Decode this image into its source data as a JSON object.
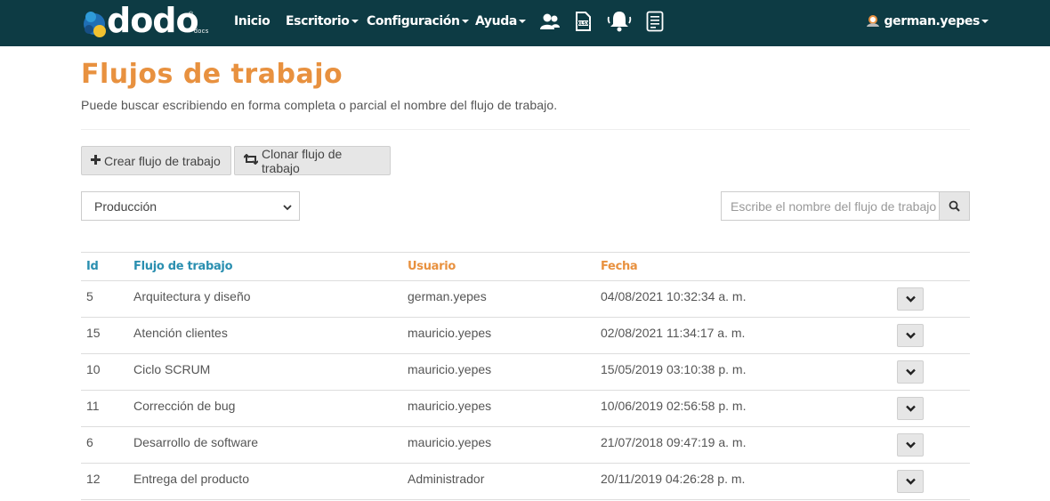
{
  "app": {
    "logo_text": "dodo",
    "logo_sub": "docs",
    "logo_reg": "®"
  },
  "nav": {
    "items": [
      {
        "label": "Inicio",
        "dropdown": false
      },
      {
        "label": "Escritorio",
        "dropdown": true
      },
      {
        "label": "Configuración",
        "dropdown": true
      },
      {
        "label": "Ayuda",
        "dropdown": true
      }
    ],
    "icons": [
      "users-icon",
      "xlsx-file-icon",
      "bell-icon",
      "document-list-icon"
    ],
    "user": "german.yepes"
  },
  "page": {
    "title": "Flujos de trabajo",
    "subtitle": "Puede buscar escribiendo en forma completa o parcial el nombre del flujo de trabajo."
  },
  "toolbar": {
    "create_label": "Crear flujo de trabajo",
    "clone_label": "Clonar flujo de trabajo"
  },
  "filter": {
    "selected": "Producción"
  },
  "search": {
    "placeholder": "Escribe el nombre del flujo de trabajo"
  },
  "table": {
    "headers": {
      "id": "Id",
      "flow": "Flujo de trabajo",
      "user": "Usuario",
      "date": "Fecha"
    },
    "rows": [
      {
        "id": "5",
        "flow": "Arquitectura y diseño",
        "user": "german.yepes",
        "date": "04/08/2021 10:32:34 a. m."
      },
      {
        "id": "15",
        "flow": "Atención clientes",
        "user": "mauricio.yepes",
        "date": "02/08/2021 11:34:17 a. m."
      },
      {
        "id": "10",
        "flow": "Ciclo SCRUM",
        "user": "mauricio.yepes",
        "date": "15/05/2019 03:10:38 p. m."
      },
      {
        "id": "11",
        "flow": "Corrección de bug",
        "user": "mauricio.yepes",
        "date": "10/06/2019 02:56:58 p. m."
      },
      {
        "id": "6",
        "flow": "Desarrollo de software",
        "user": "mauricio.yepes",
        "date": "21/07/2018 09:47:19 a. m."
      },
      {
        "id": "12",
        "flow": "Entrega del producto",
        "user": "Administrador",
        "date": "20/11/2019 04:26:28 p. m."
      }
    ]
  },
  "colors": {
    "navbar": "#0d3b44",
    "title": "#e8913f",
    "header_blue": "#2a8fb0",
    "header_orange": "#e8913f"
  }
}
